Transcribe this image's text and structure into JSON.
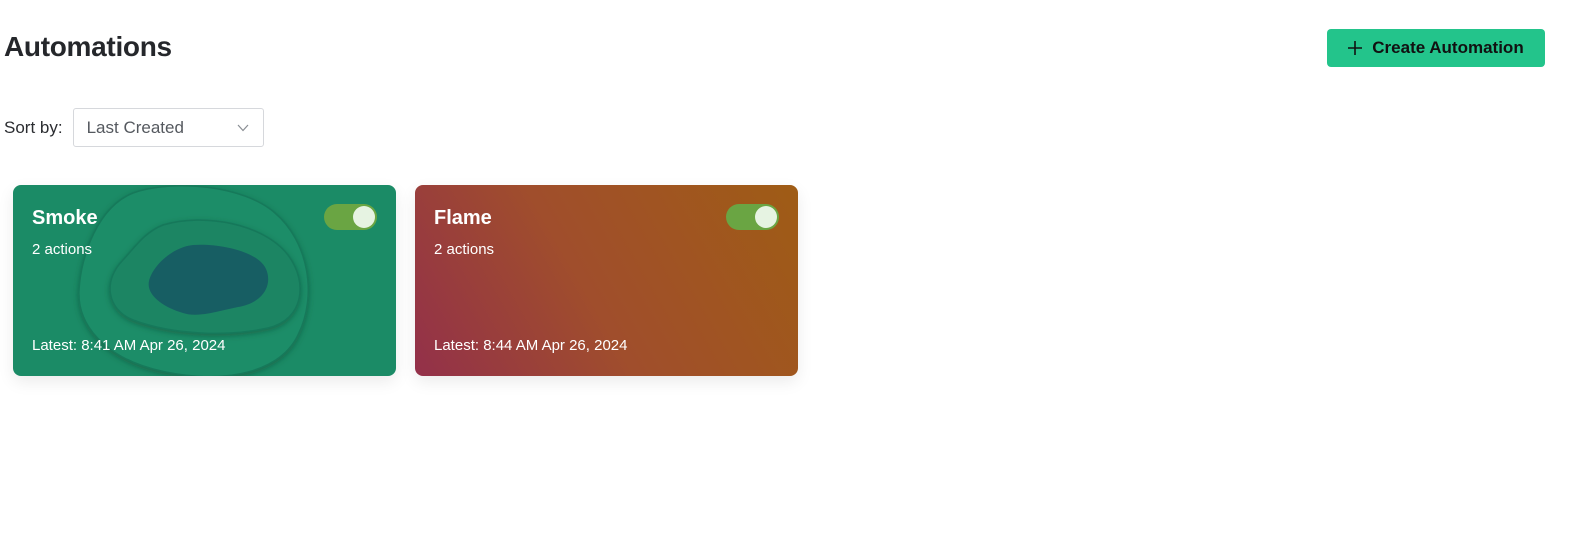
{
  "header": {
    "title": "Automations",
    "create_button_label": "Create Automation",
    "create_button_icon": "plus-icon"
  },
  "sort": {
    "label": "Sort by:",
    "selected": "Last Created",
    "icon": "chevron-down-icon"
  },
  "automations": [
    {
      "name": "Smoke",
      "actions": "2 actions",
      "latest": "Latest: 8:41 AM Apr 26, 2024",
      "enabled": true,
      "color": "#1b8b66"
    },
    {
      "name": "Flame",
      "actions": "2 actions",
      "latest": "Latest: 8:44 AM Apr 26, 2024",
      "enabled": true,
      "color": "#9a4a2a"
    }
  ],
  "colors": {
    "accent": "#23c48b",
    "toggle_on": "#6aa543"
  }
}
